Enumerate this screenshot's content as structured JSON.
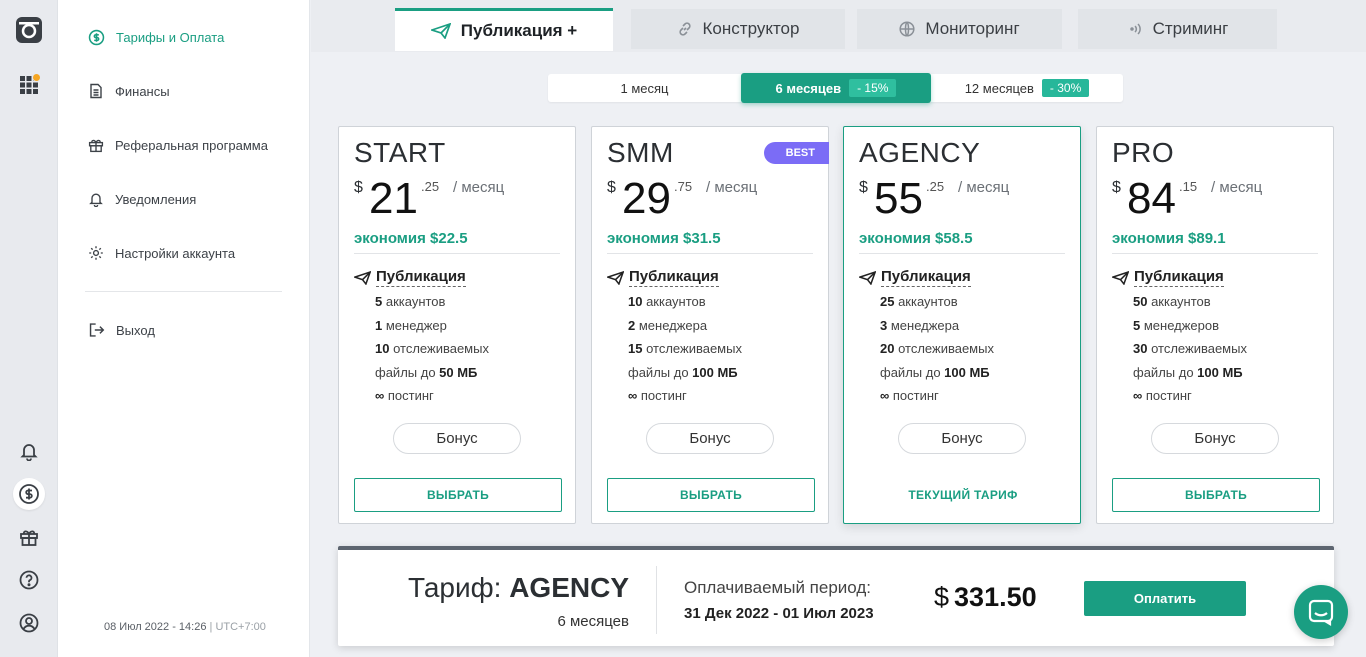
{
  "menu": {
    "items": [
      {
        "label": "Тарифы и Оплата"
      },
      {
        "label": "Финансы"
      },
      {
        "label": "Реферальная программа"
      },
      {
        "label": "Уведомления"
      },
      {
        "label": "Настройки аккаунта"
      }
    ],
    "logout": "Выход",
    "datetime": "08 Июл 2022 - 14:26",
    "sep": "|",
    "timezone": "UTC+7:00"
  },
  "tabs": [
    {
      "label": "Публикация +",
      "icon": "paper-plane-icon"
    },
    {
      "label": "Конструктор",
      "icon": "link-icon"
    },
    {
      "label": "Мониторинг",
      "icon": "globe-icon"
    },
    {
      "label": "Стриминг",
      "icon": "broadcast-icon"
    }
  ],
  "period": {
    "options": [
      {
        "label": "1 месяц",
        "discount": ""
      },
      {
        "label": "6 месяцев",
        "discount": "- 15%"
      },
      {
        "label": "12 месяцев",
        "discount": "- 30%"
      }
    ],
    "selected": "6 месяцев"
  },
  "currency": "$",
  "per_label": "/ месяц",
  "feature_header": "Публикация",
  "bonus_label": "Бонус",
  "choose_label": "ВЫБРАТЬ",
  "current_label": "ТЕКУЩИЙ ТАРИФ",
  "plans": [
    {
      "name": "START",
      "badge": "",
      "int": "21",
      "dec": ".25",
      "saving": "экономия $22.5",
      "f1n": "5",
      "f1t": " аккаунтов",
      "f2n": "1",
      "f2t": " менеджер",
      "f3n": "10",
      "f3t": " отслеживаемых",
      "f4a": "файлы до ",
      "f4b": "50 МБ",
      "f5n": "∞",
      "f5t": " постинг"
    },
    {
      "name": "SMM",
      "badge": "BEST",
      "int": "29",
      "dec": ".75",
      "saving": "экономия $31.5",
      "f1n": "10",
      "f1t": " аккаунтов",
      "f2n": "2",
      "f2t": " менеджера",
      "f3n": "15",
      "f3t": " отслеживаемых",
      "f4a": "файлы до ",
      "f4b": "100 МБ",
      "f5n": "∞",
      "f5t": " постинг"
    },
    {
      "name": "AGENCY",
      "badge": "",
      "int": "55",
      "dec": ".25",
      "saving": "экономия $58.5",
      "f1n": "25",
      "f1t": " аккаунтов",
      "f2n": "3",
      "f2t": " менеджера",
      "f3n": "20",
      "f3t": " отслеживаемых",
      "f4a": "файлы до ",
      "f4b": "100 МБ",
      "f5n": "∞",
      "f5t": " постинг"
    },
    {
      "name": "PRO",
      "badge": "",
      "int": "84",
      "dec": ".15",
      "saving": "экономия $89.1",
      "f1n": "50",
      "f1t": " аккаунтов",
      "f2n": "5",
      "f2t": " менеджеров",
      "f3n": "30",
      "f3t": " отслеживаемых",
      "f4a": "файлы до ",
      "f4b": "100 МБ",
      "f5n": "∞",
      "f5t": " постинг"
    }
  ],
  "summary": {
    "plan_prefix": "Тариф: ",
    "plan_name": "AGENCY",
    "months": "6 месяцев",
    "period_label": "Оплачиваемый период:",
    "period_dates": "31 Дек 2022 - 01 Июл 2023",
    "currency": "$",
    "total": "331.50",
    "pay_label": "Оплатить"
  },
  "colors": {
    "accent": "#1a9e82",
    "badge": "#7b6cf6",
    "notification_dot": "#f5a623"
  }
}
